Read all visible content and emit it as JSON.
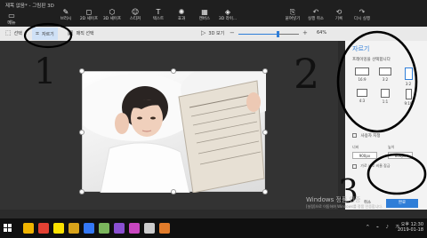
{
  "window": {
    "title": "제목 없음* - 그림판 3D",
    "menu_label": "메뉴"
  },
  "tools": [
    {
      "label": "브러시",
      "icon": "brush-icon",
      "glyph": "✎"
    },
    {
      "label": "2D 셰이프",
      "icon": "shapes-2d-icon",
      "glyph": "◻"
    },
    {
      "label": "3D 셰이프",
      "icon": "shapes-3d-icon",
      "glyph": "⬡"
    },
    {
      "label": "스티커",
      "icon": "sticker-icon",
      "glyph": "☺"
    },
    {
      "label": "텍스트",
      "icon": "text-icon",
      "glyph": "T"
    },
    {
      "label": "효과",
      "icon": "effects-icon",
      "glyph": "✺"
    },
    {
      "label": "캔버스",
      "icon": "canvas-icon",
      "glyph": "▦"
    },
    {
      "label": "3D 라이...",
      "icon": "3d-library-icon",
      "glyph": "◈"
    }
  ],
  "right_tools": [
    {
      "label": "붙여넣기",
      "icon": "paste-icon",
      "glyph": "⎘"
    },
    {
      "label": "실행 취소",
      "icon": "undo-icon",
      "glyph": "↶"
    },
    {
      "label": "기록",
      "icon": "history-icon",
      "glyph": "⟲"
    },
    {
      "label": "다시 실행",
      "icon": "redo-icon",
      "glyph": "↷"
    }
  ],
  "window_controls": "–  ❐  ✕",
  "toolbar": {
    "select_label": "선택",
    "crop_label": "자르기",
    "magic_select_label": "매직 선택",
    "view_3d_label": "3D 보기",
    "zoom_percent": "64%",
    "zoom_level": 0.64
  },
  "panel": {
    "title": "자르기",
    "subtitle": "프레이밍을 선택합니다",
    "ratios": [
      "16:9",
      "3:2",
      "3:2",
      "4:3",
      "1:1",
      "9:16"
    ],
    "custom_label": "사용자 지정",
    "width_label": "너비",
    "height_label": "높이",
    "width_value": "900px",
    "height_value": "600px",
    "lock_label": "가로 세로 비율 잠금",
    "cancel_label": "취소",
    "done_label": "완료"
  },
  "annotations": {
    "one": "1",
    "two": "2",
    "three": "3"
  },
  "watermark": {
    "line1": "Windows 정품 인증",
    "line2": "[설정]으로 이동하여 Windows를 정품 인증합니다."
  },
  "taskbar": {
    "apps": [
      "file-explorer-icon",
      "chrome-icon",
      "kakao-icon",
      "folder-icon",
      "app-icon",
      "app-icon-2",
      "app-icon-3",
      "paint3d-icon",
      "settings-icon",
      "app-icon-4"
    ],
    "tray": "^ ⌁ ♪ 가",
    "time": "오후 12:30",
    "date": "2019-01-18"
  }
}
